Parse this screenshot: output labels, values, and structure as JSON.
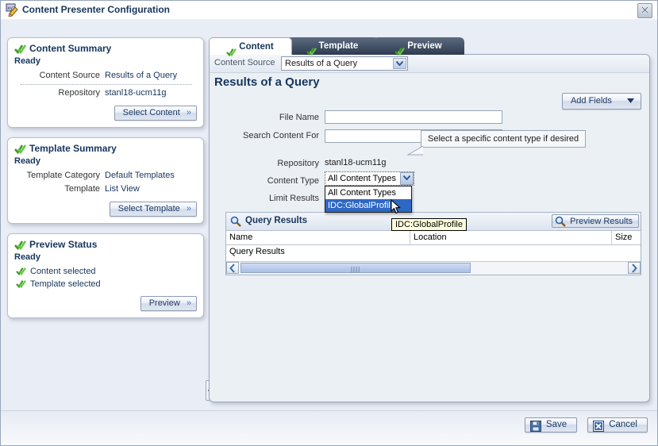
{
  "window": {
    "title": "Content Presenter Configuration",
    "icon": "edit-page-icon",
    "close_icon": "close-icon"
  },
  "sidebar": {
    "panels": [
      {
        "name": "content-summary",
        "title": "Content Summary",
        "status": "Ready",
        "fields": [
          {
            "label": "Content Source",
            "value": "Results of a Query"
          },
          {
            "label": "Repository",
            "value": "stanl18-ucm11g"
          }
        ],
        "button": "Select Content"
      },
      {
        "name": "template-summary",
        "title": "Template Summary",
        "status": "Ready",
        "fields": [
          {
            "label": "Template Category",
            "value": "Default Templates"
          },
          {
            "label": "Template",
            "value": "List View"
          }
        ],
        "button": "Select Template"
      },
      {
        "name": "preview-status",
        "title": "Preview Status",
        "status": "Ready",
        "checks": [
          "Content selected",
          "Template selected"
        ],
        "button": "Preview"
      }
    ]
  },
  "tabs": [
    {
      "label": "Content",
      "active": true
    },
    {
      "label": "Template",
      "active": false
    },
    {
      "label": "Preview",
      "active": false
    }
  ],
  "content": {
    "source_label": "Content Source",
    "source_value": "Results of a Query",
    "source_options": [
      "Results of a Query"
    ],
    "page_title": "Results of a Query",
    "add_fields_label": "Add Fields",
    "form": [
      {
        "name": "file-name",
        "label": "File Name",
        "type": "input",
        "value": "",
        "placeholder": ""
      },
      {
        "name": "search-content-for",
        "label": "Search Content For",
        "type": "input",
        "value": "",
        "placeholder": ""
      },
      {
        "name": "repository",
        "label": "Repository",
        "type": "text",
        "value": "stanl18-ucm11g"
      },
      {
        "name": "content-type",
        "label": "Content Type",
        "type": "select",
        "value": "All Content Types"
      },
      {
        "name": "limit-results",
        "label": "Limit Results",
        "type": "text",
        "value": ""
      }
    ],
    "content_type_options": [
      {
        "label": "All Content Types",
        "selected": false
      },
      {
        "label": "IDC:GlobalProfile",
        "selected": true
      }
    ],
    "tooltip": "Select a specific content type if desired",
    "hover_tooltip": "IDC:GlobalProfile"
  },
  "results": {
    "title": "Query Results",
    "preview_button": "Preview Results",
    "columns": [
      "Name",
      "Location",
      "Size"
    ],
    "rows": [
      {
        "name": "Query Results",
        "location": "",
        "size": ""
      }
    ]
  },
  "footer": {
    "save_label": "Save",
    "cancel_label": "Cancel"
  },
  "colors": {
    "accent": "#17365d",
    "tab_inactive": "#3a475c",
    "selection": "#2f68c4",
    "tooltip_bg": "#ffffdd"
  }
}
